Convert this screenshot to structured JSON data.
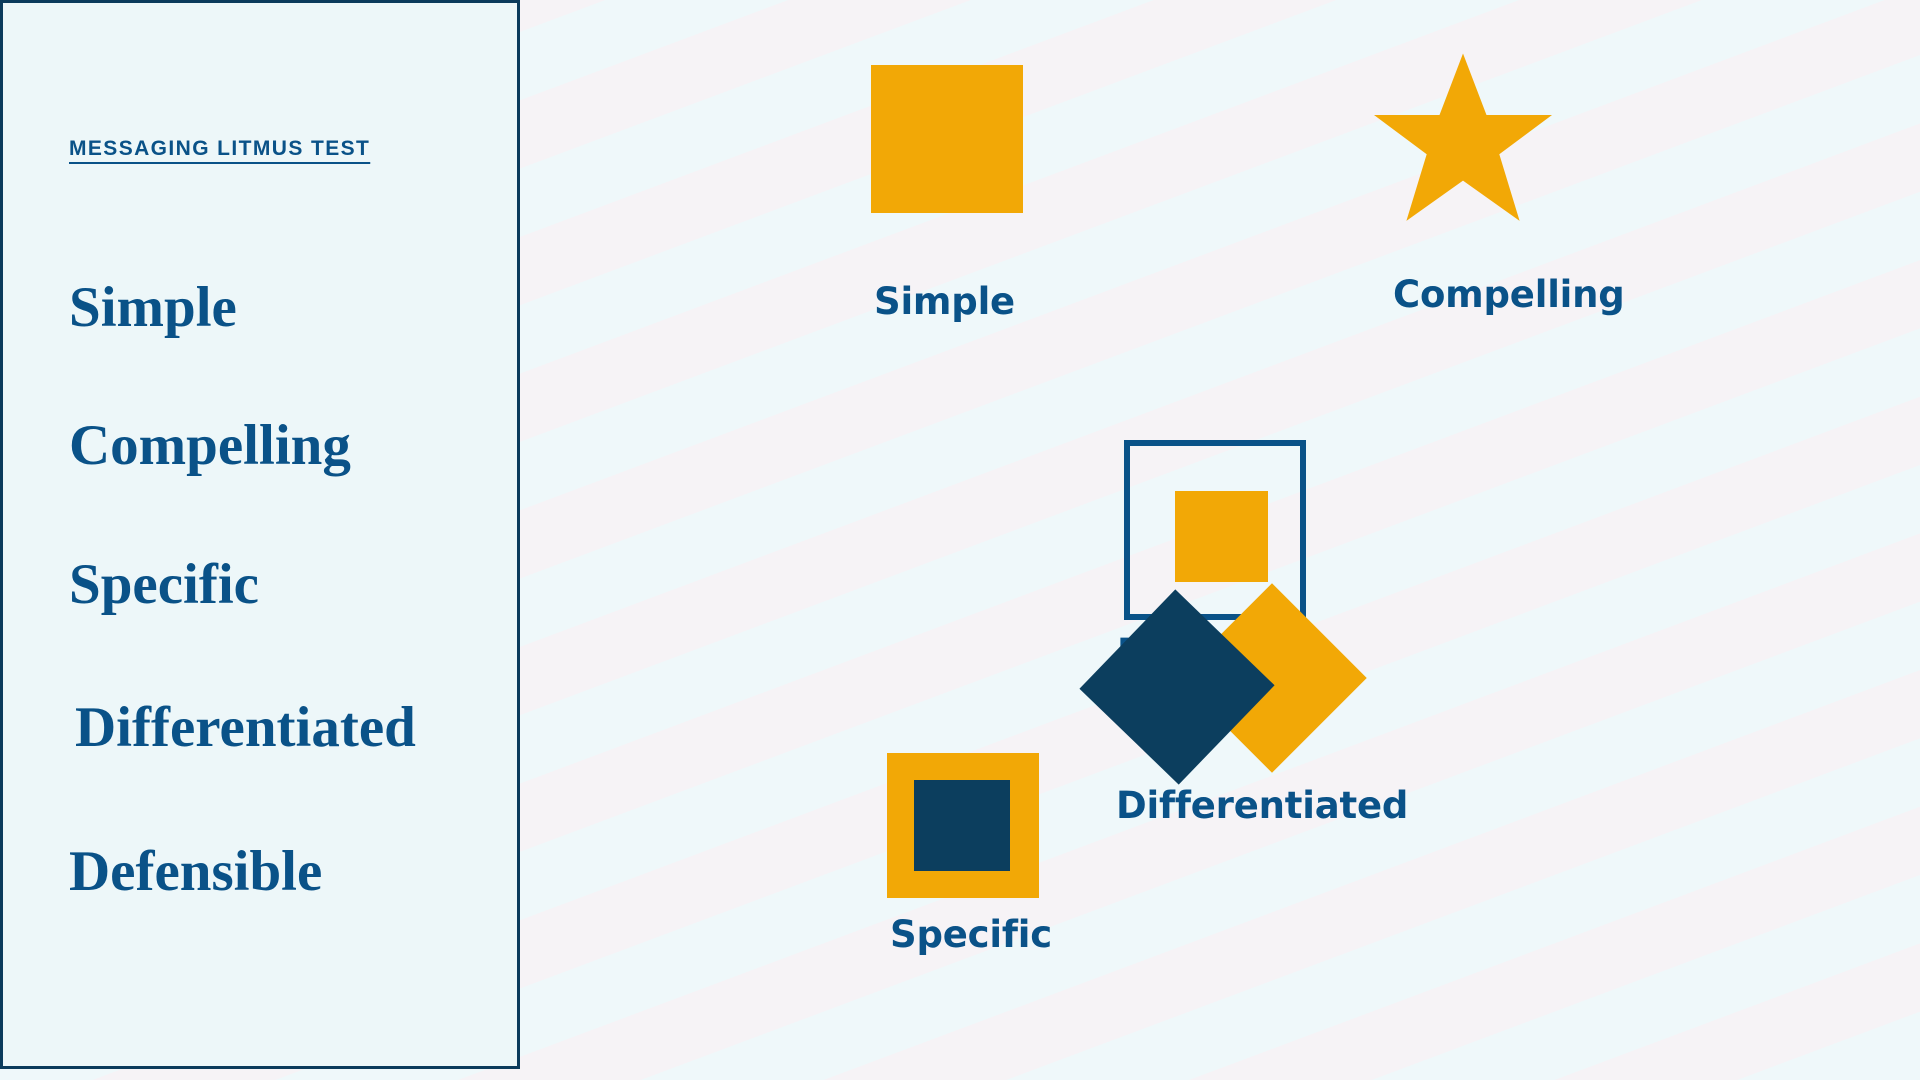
{
  "sidebar": {
    "eyebrow": "MESSAGING LITMUS TEST",
    "items": [
      {
        "label": "Simple"
      },
      {
        "label": "Compelling"
      },
      {
        "label": "Specific"
      },
      {
        "label": "Differentiated"
      },
      {
        "label": "Defensible"
      }
    ]
  },
  "diagram": {
    "nodes": [
      {
        "key": "simple",
        "caption": "Simple",
        "icon": "filled-square-icon"
      },
      {
        "key": "compelling",
        "caption": "Compelling",
        "icon": "star-icon"
      },
      {
        "key": "defensible",
        "caption": "Defensible",
        "icon": "outlined-square-with-core-icon"
      },
      {
        "key": "specific",
        "caption": "Specific",
        "icon": "square-in-square-icon"
      },
      {
        "key": "differentiated",
        "caption": "Differentiated",
        "icon": "overlapping-diamonds-icon"
      }
    ]
  },
  "colors": {
    "accent_orange": "#F2A806",
    "navy": "#0C3E5E",
    "link_blue": "#0A5288",
    "panel_bg": "#EDF7F9",
    "stage_bg": "#F6F3F6",
    "stripe_bg": "#EFF8FA"
  }
}
